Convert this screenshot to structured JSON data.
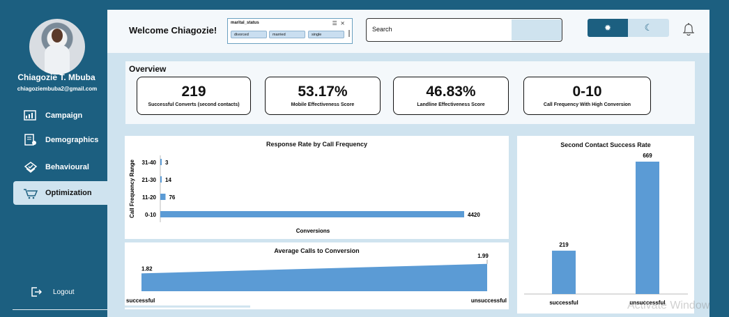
{
  "user": {
    "name": "Chiagozie T. Mbuba",
    "email": "chiagoziembuba2@gmail.com"
  },
  "nav": {
    "items": [
      {
        "label": "Campaign",
        "icon": "campaign-icon"
      },
      {
        "label": "Demographics",
        "icon": "demographics-icon"
      },
      {
        "label": "Behavioural",
        "icon": "behavioural-icon"
      },
      {
        "label": "Optimization",
        "icon": "optimization-icon",
        "active": true
      }
    ],
    "logout_label": "Logout"
  },
  "header": {
    "welcome": "Welcome Chiagozie!",
    "slicer": {
      "title": "marital_status",
      "options": [
        "divorced",
        "married",
        "single"
      ]
    },
    "search_label": "Search",
    "theme": {
      "light_icon": "sun-icon",
      "dark_icon": "moon-icon"
    }
  },
  "overview": {
    "title": "Overview",
    "kpis": [
      {
        "value": "219",
        "label": "Successful Converts (second contacts)"
      },
      {
        "value": "53.17%",
        "label": "Mobile Effectiveness Score"
      },
      {
        "value": "46.83%",
        "label": "Landline Effectiveness Score"
      },
      {
        "value": "0-10",
        "label": "Call Frequency With High Conversion"
      }
    ]
  },
  "colors": {
    "accent": "#1c5f80",
    "bar": "#5b9bd5",
    "panel_bg": "#cfe3ef"
  },
  "chart_data": [
    {
      "type": "bar",
      "orientation": "horizontal",
      "title": "Response Rate by Call Frequency",
      "xlabel": "Conversions",
      "ylabel": "Call Frequency Range",
      "categories": [
        "0-10",
        "11-20",
        "21-30",
        "31-40"
      ],
      "values": [
        4420,
        76,
        14,
        3
      ]
    },
    {
      "type": "area",
      "title": "Average Calls to Conversion",
      "categories": [
        "successful",
        "unsuccessful"
      ],
      "values": [
        1.82,
        1.99
      ]
    },
    {
      "type": "bar",
      "title": "Second Contact Success Rate",
      "categories": [
        "successful",
        "unsuccessful"
      ],
      "values": [
        219,
        669
      ]
    }
  ],
  "watermark": "Activate Window"
}
